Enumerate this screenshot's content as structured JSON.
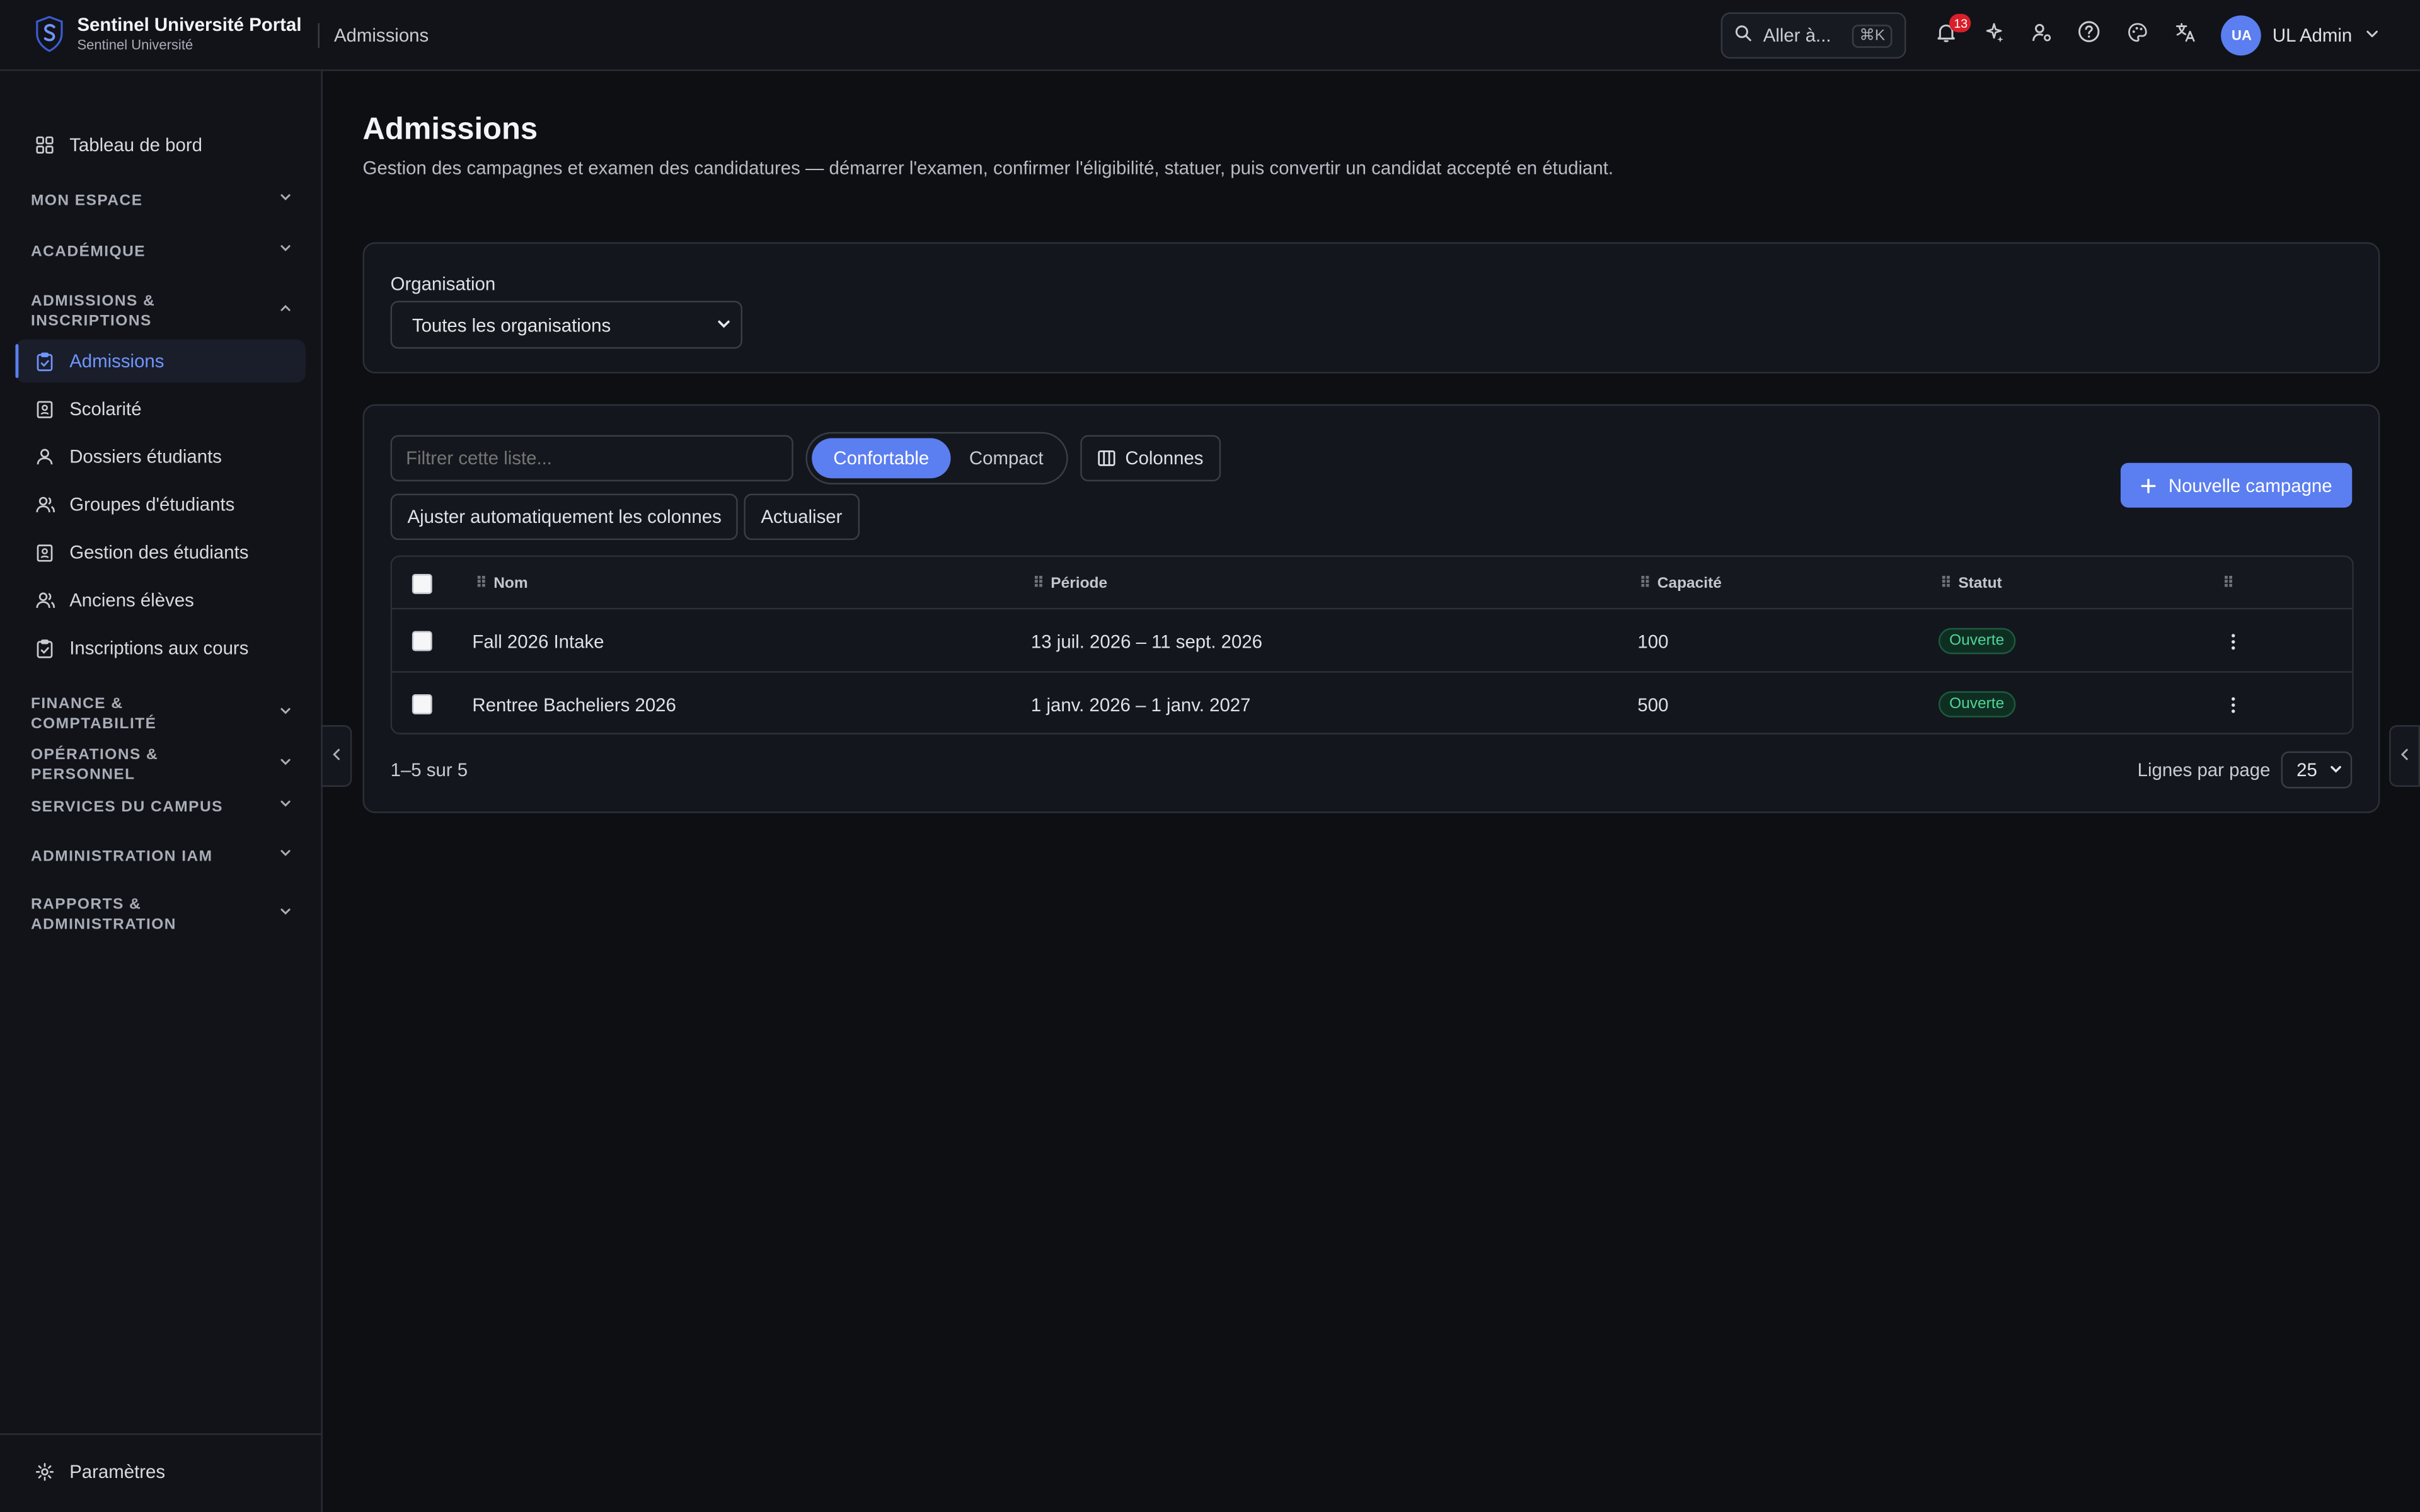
{
  "app": {
    "title": "Sentinel Université Portal",
    "subtitle": "Sentinel Université",
    "breadcrumb": "Admissions"
  },
  "topbar": {
    "jump_label": "Aller à...",
    "jump_shortcut": "⌘K",
    "notification_count": "13",
    "user_initials": "UA",
    "user_name": "UL Admin"
  },
  "sidebar": {
    "dashboard": "Tableau de bord",
    "sections": {
      "mon_espace": "MON ESPACE",
      "academique": "ACADÉMIQUE",
      "admissions": "ADMISSIONS & INSCRIPTIONS",
      "finance": "FINANCE & COMPTABILITÉ",
      "operations": "OPÉRATIONS & PERSONNEL",
      "services": "SERVICES DU CAMPUS",
      "iam": "ADMINISTRATION IAM",
      "rapports": "RAPPORTS & ADMINISTRATION"
    },
    "items": [
      {
        "label": "Admissions"
      },
      {
        "label": "Scolarité"
      },
      {
        "label": "Dossiers étudiants"
      },
      {
        "label": "Groupes d'étudiants"
      },
      {
        "label": "Gestion des étudiants"
      },
      {
        "label": "Anciens élèves"
      },
      {
        "label": "Inscriptions aux cours"
      }
    ],
    "settings": "Paramètres"
  },
  "page": {
    "title": "Admissions",
    "description": "Gestion des campagnes et examen des candidatures — démarrer l'examen, confirmer l'éligibilité, statuer, puis convertir un candidat accepté en étudiant."
  },
  "org_filter": {
    "label": "Organisation",
    "selected": "Toutes les organisations"
  },
  "toolbar": {
    "filter_placeholder": "Filtrer cette liste...",
    "density_comfortable": "Confortable",
    "density_compact": "Compact",
    "columns": "Colonnes",
    "autofit": "Ajuster automatiquement les colonnes",
    "refresh": "Actualiser",
    "new_campaign": "Nouvelle campagne"
  },
  "table": {
    "headers": {
      "name": "Nom",
      "period": "Période",
      "capacity": "Capacité",
      "status": "Statut"
    },
    "rows": [
      {
        "name": "Fall 2026 Intake",
        "period": "13 juil. 2026 – 11 sept. 2026",
        "capacity": "100",
        "status": "Ouverte"
      },
      {
        "name": "Rentree Bacheliers 2026",
        "period": "1 janv. 2026 – 1 janv. 2027",
        "capacity": "500",
        "status": "Ouverte"
      }
    ]
  },
  "pagination": {
    "summary": "1–5 sur 5",
    "rows_label": "Lignes par page",
    "rows_value": "25"
  },
  "colors": {
    "accent": "#5b7ef0",
    "status_open": "#4fd69a",
    "badge": "#d81f2a"
  }
}
